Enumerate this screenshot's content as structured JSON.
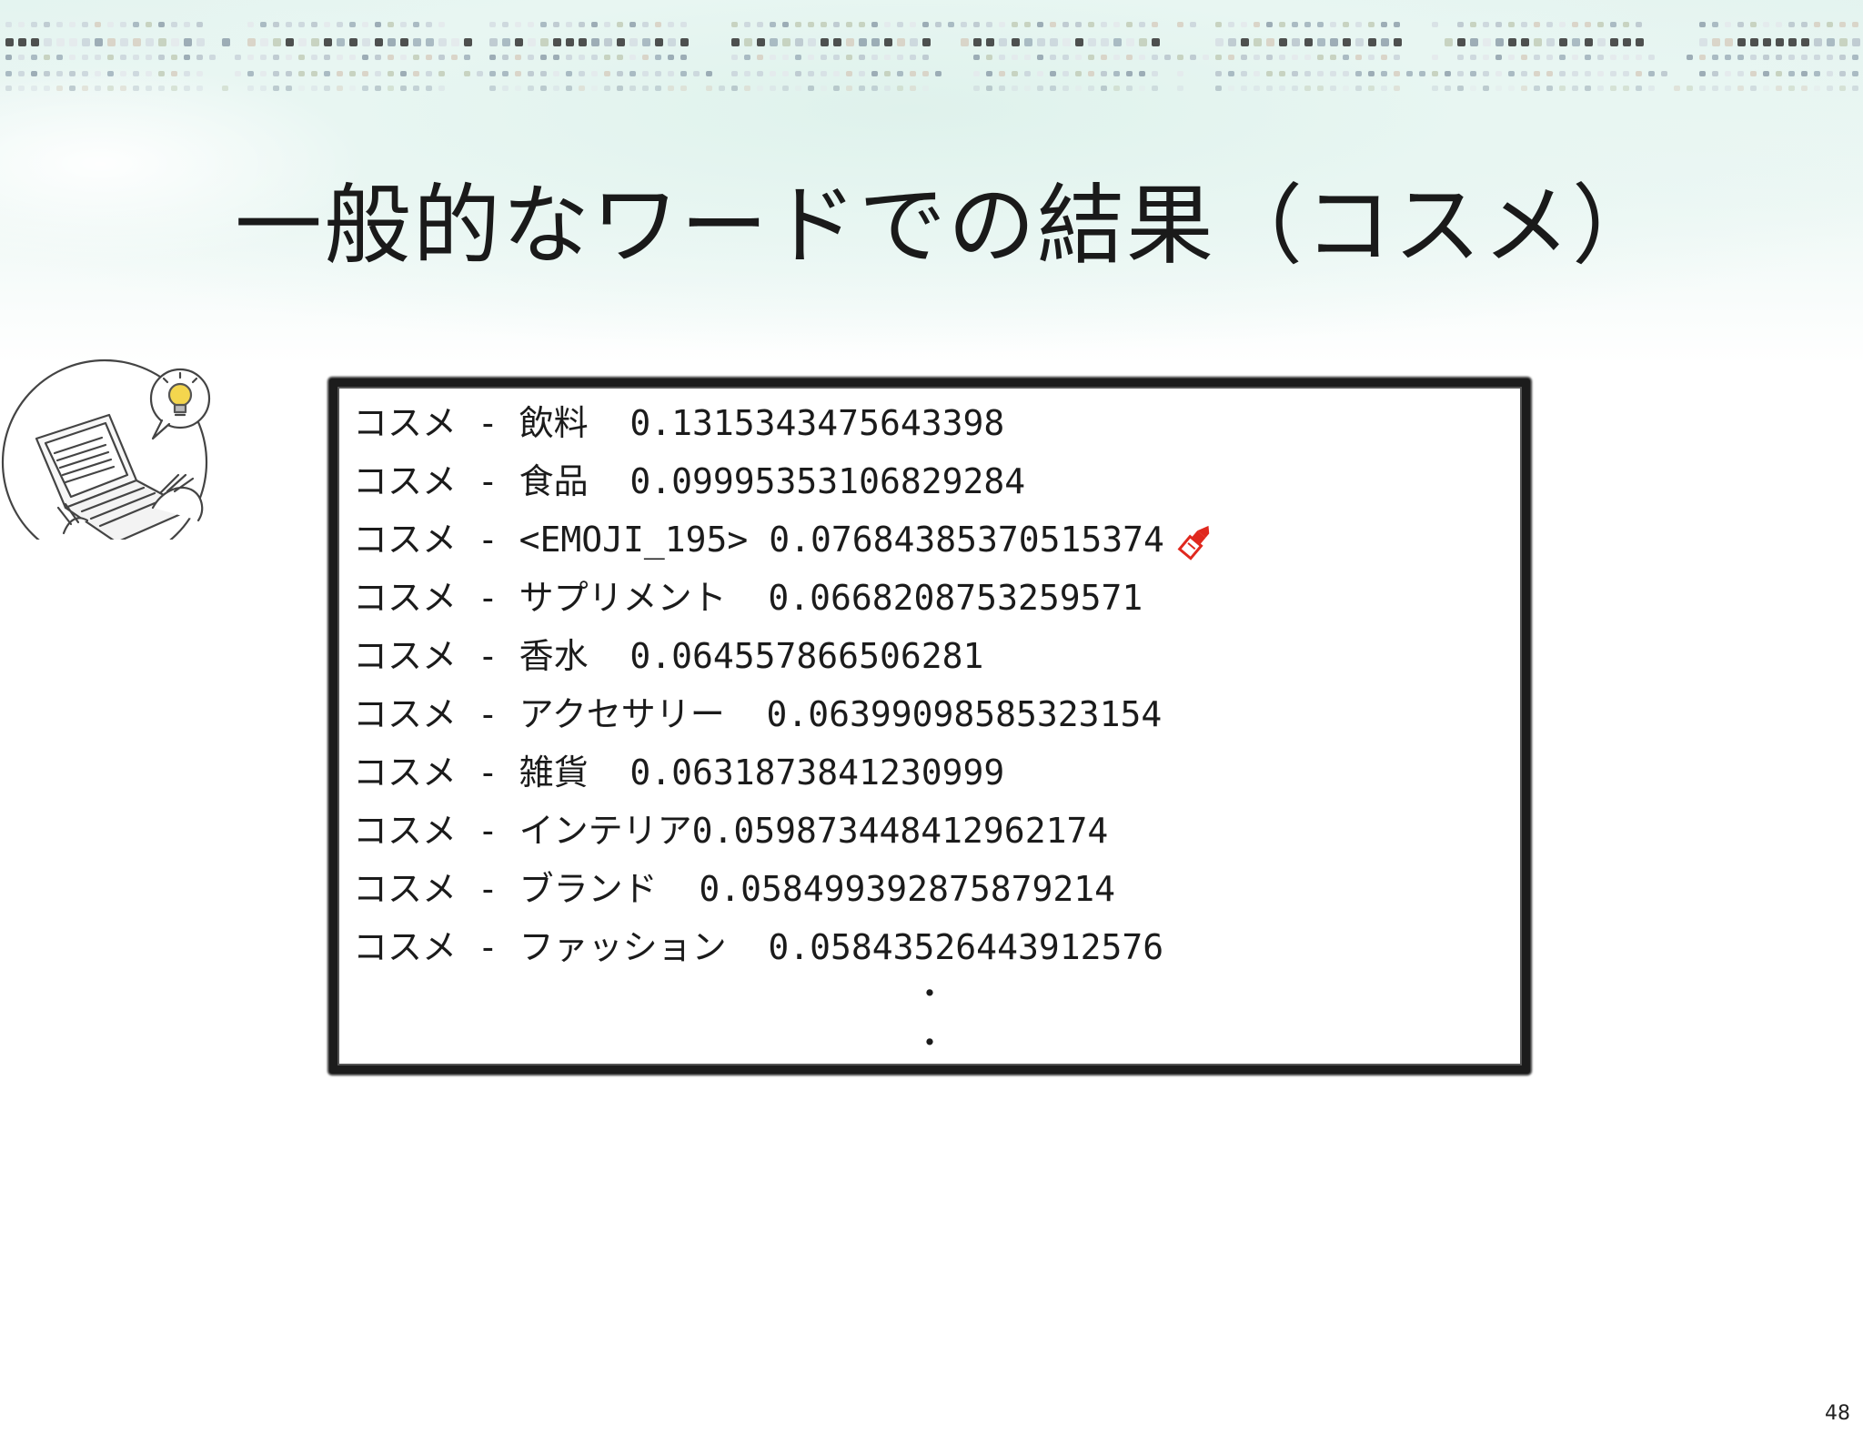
{
  "slide": {
    "title": "一般的なワードでの結果（コスメ）",
    "page_number": "48"
  },
  "results": [
    {
      "pair": "コスメ - 飲料",
      "pad": "  ",
      "score": "0.1315343475643398"
    },
    {
      "pair": "コスメ - 食品",
      "pad": "  ",
      "score": "0.09995353106829284"
    },
    {
      "pair": "コスメ - <EMOJI_195>",
      "pad": " ",
      "score": "0.07684385370515374",
      "icon": "lipstick-icon"
    },
    {
      "pair": "コスメ - サプリメント",
      "pad": "  ",
      "score": "0.0668208753259571"
    },
    {
      "pair": "コスメ - 香水",
      "pad": "  ",
      "score": "0.064557866506281"
    },
    {
      "pair": "コスメ - アクセサリー",
      "pad": "  ",
      "score": "0.06399098585323154"
    },
    {
      "pair": "コスメ - 雑貨",
      "pad": "  ",
      "score": "0.0631873841230999"
    },
    {
      "pair": "コスメ - インテリア",
      "pad": "",
      "score": "0.059873448412962174"
    },
    {
      "pair": "コスメ - ブランド",
      "pad": "  ",
      "score": "0.058499392875879214"
    },
    {
      "pair": "コスメ - ファッション",
      "pad": "  ",
      "score": "0.05843526443912576"
    }
  ],
  "ellipsis": [
    "・",
    "・"
  ],
  "icons": {
    "header": "dot-pattern-banner",
    "illustration": "laptop-idea-icon",
    "emoji": "lipstick-icon"
  },
  "colors": {
    "title": "#1a1a1a",
    "border": "#1c1c1c",
    "lipstick": "#e0281e"
  }
}
